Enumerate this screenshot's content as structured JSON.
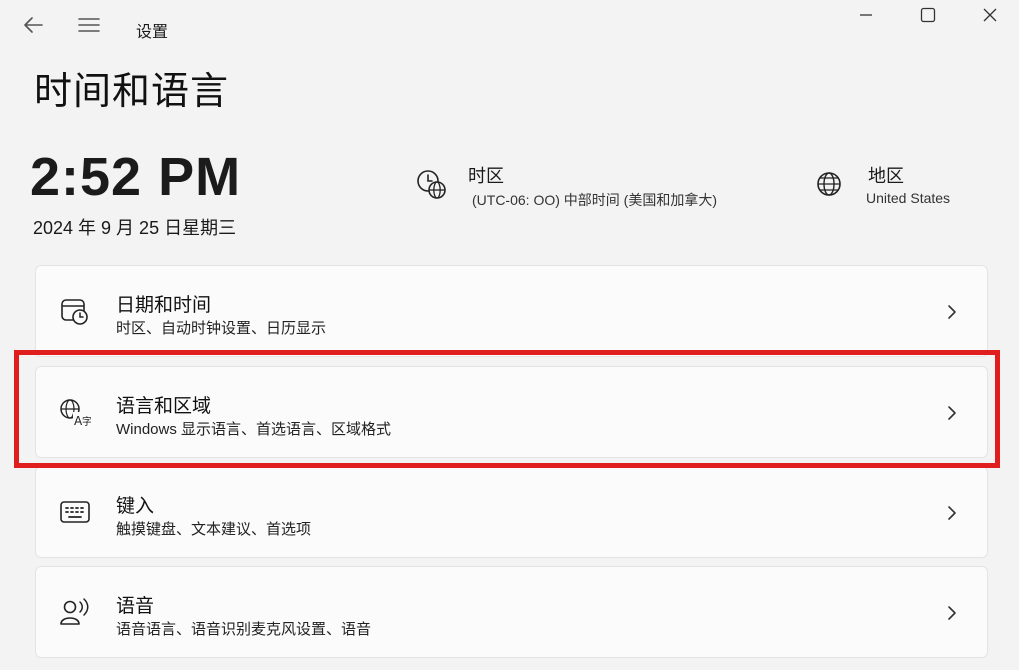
{
  "window": {
    "title": "设置"
  },
  "page": {
    "title": "时间和语言"
  },
  "clock": {
    "time": "2:52 PM",
    "date": "2024 年 9 月 25 日星期三"
  },
  "timezone": {
    "label": "时区",
    "value": "(UTC-06: OO) 中部时间 (美国和加拿大)",
    "icon": "clock-globe-icon"
  },
  "region": {
    "label": "地区",
    "value": "United States",
    "icon": "globe-icon"
  },
  "cards": [
    {
      "title": "日期和时间",
      "desc": "时区、自动时钟设置、日历显示",
      "icon": "calendar-clock-icon"
    },
    {
      "title": "语言和区域",
      "desc": "Windows 显示语言、首选语言、区域格式",
      "icon": "language-icon"
    },
    {
      "title": "键入",
      "desc": "触摸键盘、文本建议、首选项",
      "icon": "keyboard-icon"
    },
    {
      "title": "语音",
      "desc": "语音语言、语音识别麦克风设置、语音",
      "icon": "speech-icon"
    }
  ],
  "highlight": {
    "color": "#e01e1e",
    "target": "语言和区域"
  }
}
